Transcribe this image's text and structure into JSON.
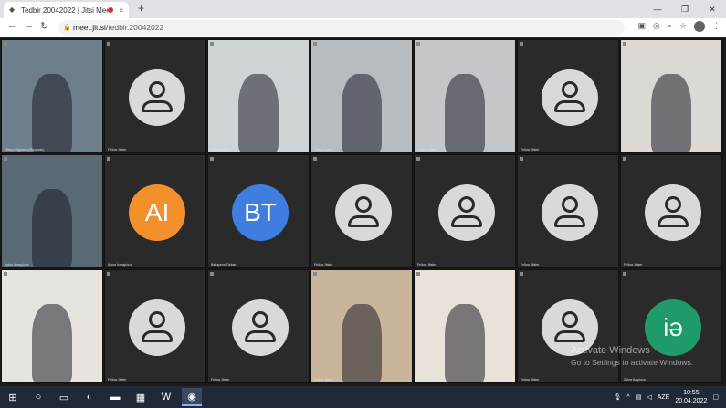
{
  "browser": {
    "tab_title": "Tedbir 20042022 | Jitsi Meet",
    "new_tab": "+",
    "close_tab": "×",
    "url_host": "meet.jit.si",
    "url_path": "/tedbir.20042022",
    "win_min": "—",
    "win_max": "❐",
    "win_close": "✕"
  },
  "tiles": [
    {
      "name": "Hüseyn Ağalarov(Naxçıvan)",
      "type": "video",
      "bg": "#6e7f8c"
    },
    {
      "name": "Fellow Jitster",
      "type": "generic"
    },
    {
      "name": "Fellow Jitster",
      "type": "video",
      "bg": "#cfd5d6"
    },
    {
      "name": "Fellow Jitster",
      "type": "video",
      "bg": "#b7bcc0"
    },
    {
      "name": "Fellow Jitster",
      "type": "video",
      "bg": "#c4c7c9"
    },
    {
      "name": "Fellow Jitster",
      "type": "generic"
    },
    {
      "name": "Gunel Məmmədova",
      "type": "video",
      "bg": "#dcd8d4"
    },
    {
      "name": "Aytən İsmayılova",
      "type": "video",
      "bg": "#5a6a75"
    },
    {
      "name": "Aynur İsmayılova",
      "type": "letter",
      "letters": "AI",
      "color": "#f4902c"
    },
    {
      "name": "Babayeva Türkan",
      "type": "letter",
      "letters": "BT",
      "color": "#3f7de0"
    },
    {
      "name": "Fellow Jitster",
      "type": "generic"
    },
    {
      "name": "Fellow Jitster",
      "type": "generic"
    },
    {
      "name": "Fellow Jitster",
      "type": "generic"
    },
    {
      "name": "Fellow Jitster",
      "type": "generic"
    },
    {
      "name": "Fellow Jitster",
      "type": "video",
      "bg": "#e7e4df"
    },
    {
      "name": "Fellow Jitster",
      "type": "generic"
    },
    {
      "name": "Fellow Jitster",
      "type": "generic"
    },
    {
      "name": "Fellow Jitster",
      "type": "video",
      "bg": "#cbb59a"
    },
    {
      "name": "Fellow Jitster",
      "type": "video",
      "bg": "#e8e2d9"
    },
    {
      "name": "Fellow Jitster",
      "type": "generic"
    },
    {
      "name": "Zəhra Bəşirova",
      "type": "letter",
      "letters": "iə",
      "color": "#1f9a6a"
    }
  ],
  "watermark": {
    "line1": "Activate Windows",
    "line2": "Go to Settings to activate Windows."
  },
  "taskbar": {
    "lang": "AZE",
    "time": "10:55",
    "date": "20.04.2022"
  }
}
